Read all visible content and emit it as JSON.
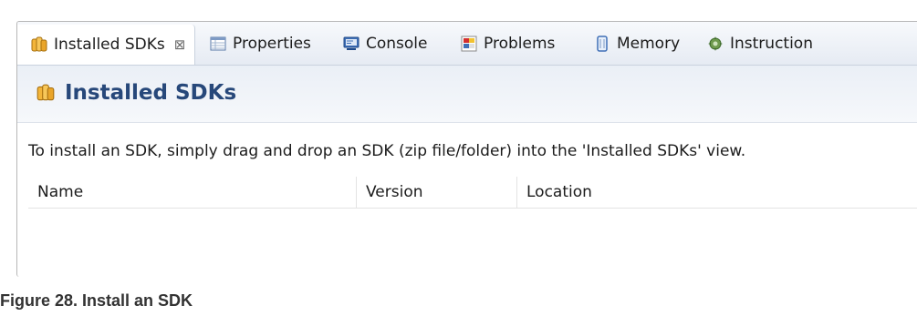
{
  "tabs": [
    {
      "label": "Installed SDKs",
      "icon": "sdk-jars-icon",
      "active": true,
      "close_glyph": "⊠"
    },
    {
      "label": "Properties",
      "icon": "properties-table-icon"
    },
    {
      "label": "Console",
      "icon": "console-monitor-icon"
    },
    {
      "label": "Problems",
      "icon": "problems-icon"
    },
    {
      "label": "Memory",
      "icon": "memory-icon"
    },
    {
      "label": "Instruction",
      "icon": "instruction-trace-icon"
    }
  ],
  "view": {
    "title": "Installed SDKs",
    "hint": "To install an SDK, simply drag and drop an SDK (zip file/folder) into the 'Installed SDKs' view."
  },
  "table": {
    "columns": [
      "Name",
      "Version",
      "Location"
    ],
    "rows": []
  },
  "caption": "Figure 28.  Install an SDK",
  "colors": {
    "title": "#27487a",
    "tabbar_bg": "#e6ebf3",
    "border": "#b7b7b7"
  }
}
